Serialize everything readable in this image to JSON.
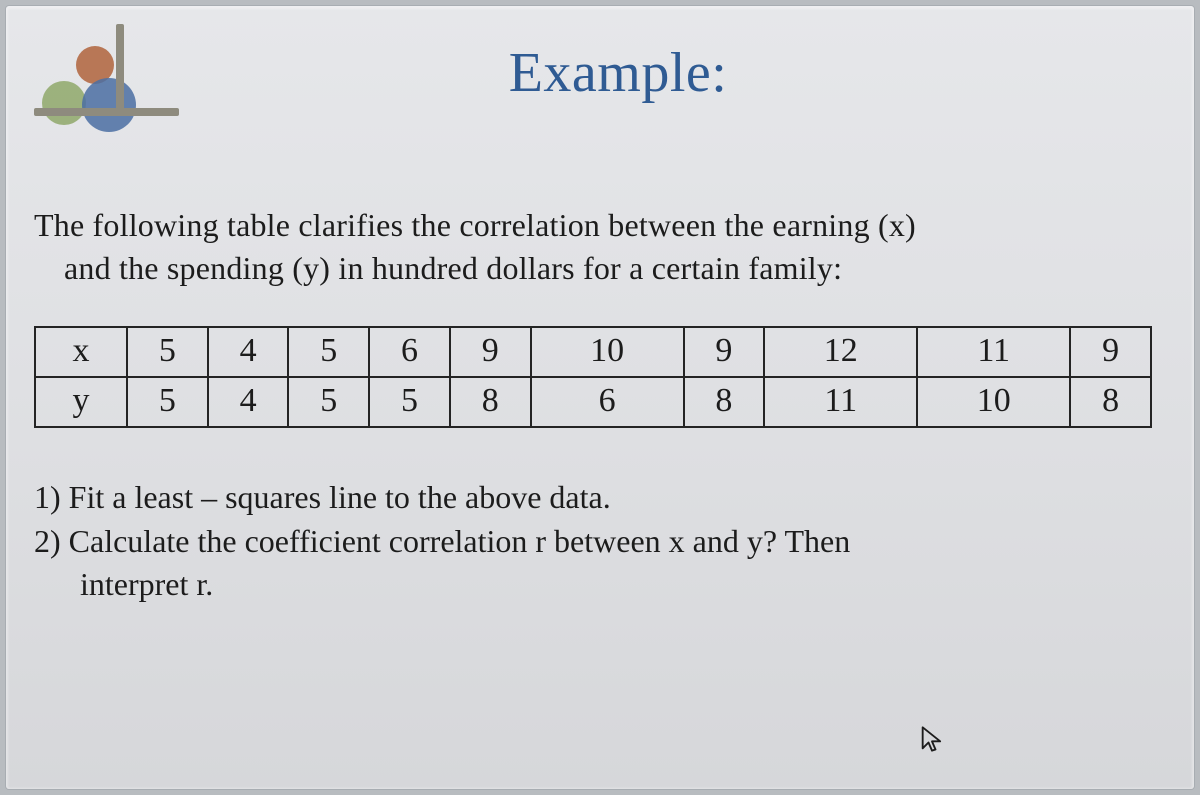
{
  "title": "Example:",
  "intro_line1": "The following table clarifies the correlation between the earning (x)",
  "intro_line2": "and the spending (y) in hundred dollars for a certain family:",
  "table": {
    "row_x_label": "x",
    "row_y_label": "y",
    "x": [
      "5",
      "4",
      "5",
      "6",
      "9",
      "10",
      "9",
      "12",
      "11",
      "9"
    ],
    "y": [
      "5",
      "4",
      "5",
      "5",
      "8",
      "6",
      "8",
      "11",
      "10",
      "8"
    ]
  },
  "q1": "1) Fit a least – squares line to the above data.",
  "q2": "2) Calculate the coefficient correlation r between x and y? Then",
  "q3": "interpret r.",
  "chart_data": {
    "type": "table",
    "title": "Correlation between earning (x) and spending (y) in hundred dollars",
    "series": [
      {
        "name": "x",
        "values": [
          5,
          4,
          5,
          6,
          9,
          10,
          9,
          12,
          11,
          9
        ]
      },
      {
        "name": "y",
        "values": [
          5,
          4,
          5,
          5,
          8,
          6,
          8,
          11,
          10,
          8
        ]
      }
    ]
  }
}
